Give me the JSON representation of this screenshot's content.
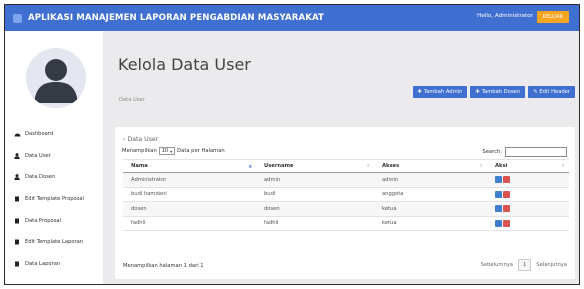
{
  "app": {
    "title": "APLIKASI MANAJEMEN LAPORAN PENGABDIAN MASYARAKAT",
    "greeting": "Hello, Administrator",
    "logout_label": "KELUAR"
  },
  "sidebar": {
    "items": [
      {
        "label": "Dashboard",
        "icon": "dashboard-icon"
      },
      {
        "label": "Data User",
        "icon": "user-icon"
      },
      {
        "label": "Data Dosen",
        "icon": "user-icon"
      },
      {
        "label": "Edit Template Proposal",
        "icon": "file-icon"
      },
      {
        "label": "Data Proposal",
        "icon": "file-icon"
      },
      {
        "label": "Edit Template Laporan",
        "icon": "file-icon"
      },
      {
        "label": "Data Laporan",
        "icon": "file-icon"
      }
    ]
  },
  "page": {
    "title": "Kelola Data User",
    "breadcrumb": "Data User"
  },
  "actions": {
    "add_admin": "Tambah Admin",
    "add_dosen": "Tambah Dosen",
    "edit_header": "Edit Header"
  },
  "panel": {
    "subtitle": "› Data User",
    "show_prefix": "Menampilkan",
    "page_size": "10",
    "show_suffix": "Data per Halaman",
    "search_label": "Search:",
    "search_value": ""
  },
  "table": {
    "columns": [
      "Nama",
      "Username",
      "Akses",
      "Aksi"
    ],
    "rows": [
      {
        "nama": "Administrator",
        "username": "admin",
        "akses": "admin"
      },
      {
        "nama": "budi hamdani",
        "username": "budi",
        "akses": "anggota"
      },
      {
        "nama": "dosen",
        "username": "dosen",
        "akses": "ketua"
      },
      {
        "nama": "fadhli",
        "username": "fadhli",
        "akses": "ketua"
      }
    ]
  },
  "footer": {
    "info": "Menampilkan halaman 1 dari 1",
    "prev": "Sebelumnya",
    "page": "1",
    "next": "Selanjutnya"
  },
  "colors": {
    "primary": "#3f6fd0",
    "logout": "#f4a623",
    "edit": "#3f7fcf",
    "delete": "#d9534f"
  }
}
